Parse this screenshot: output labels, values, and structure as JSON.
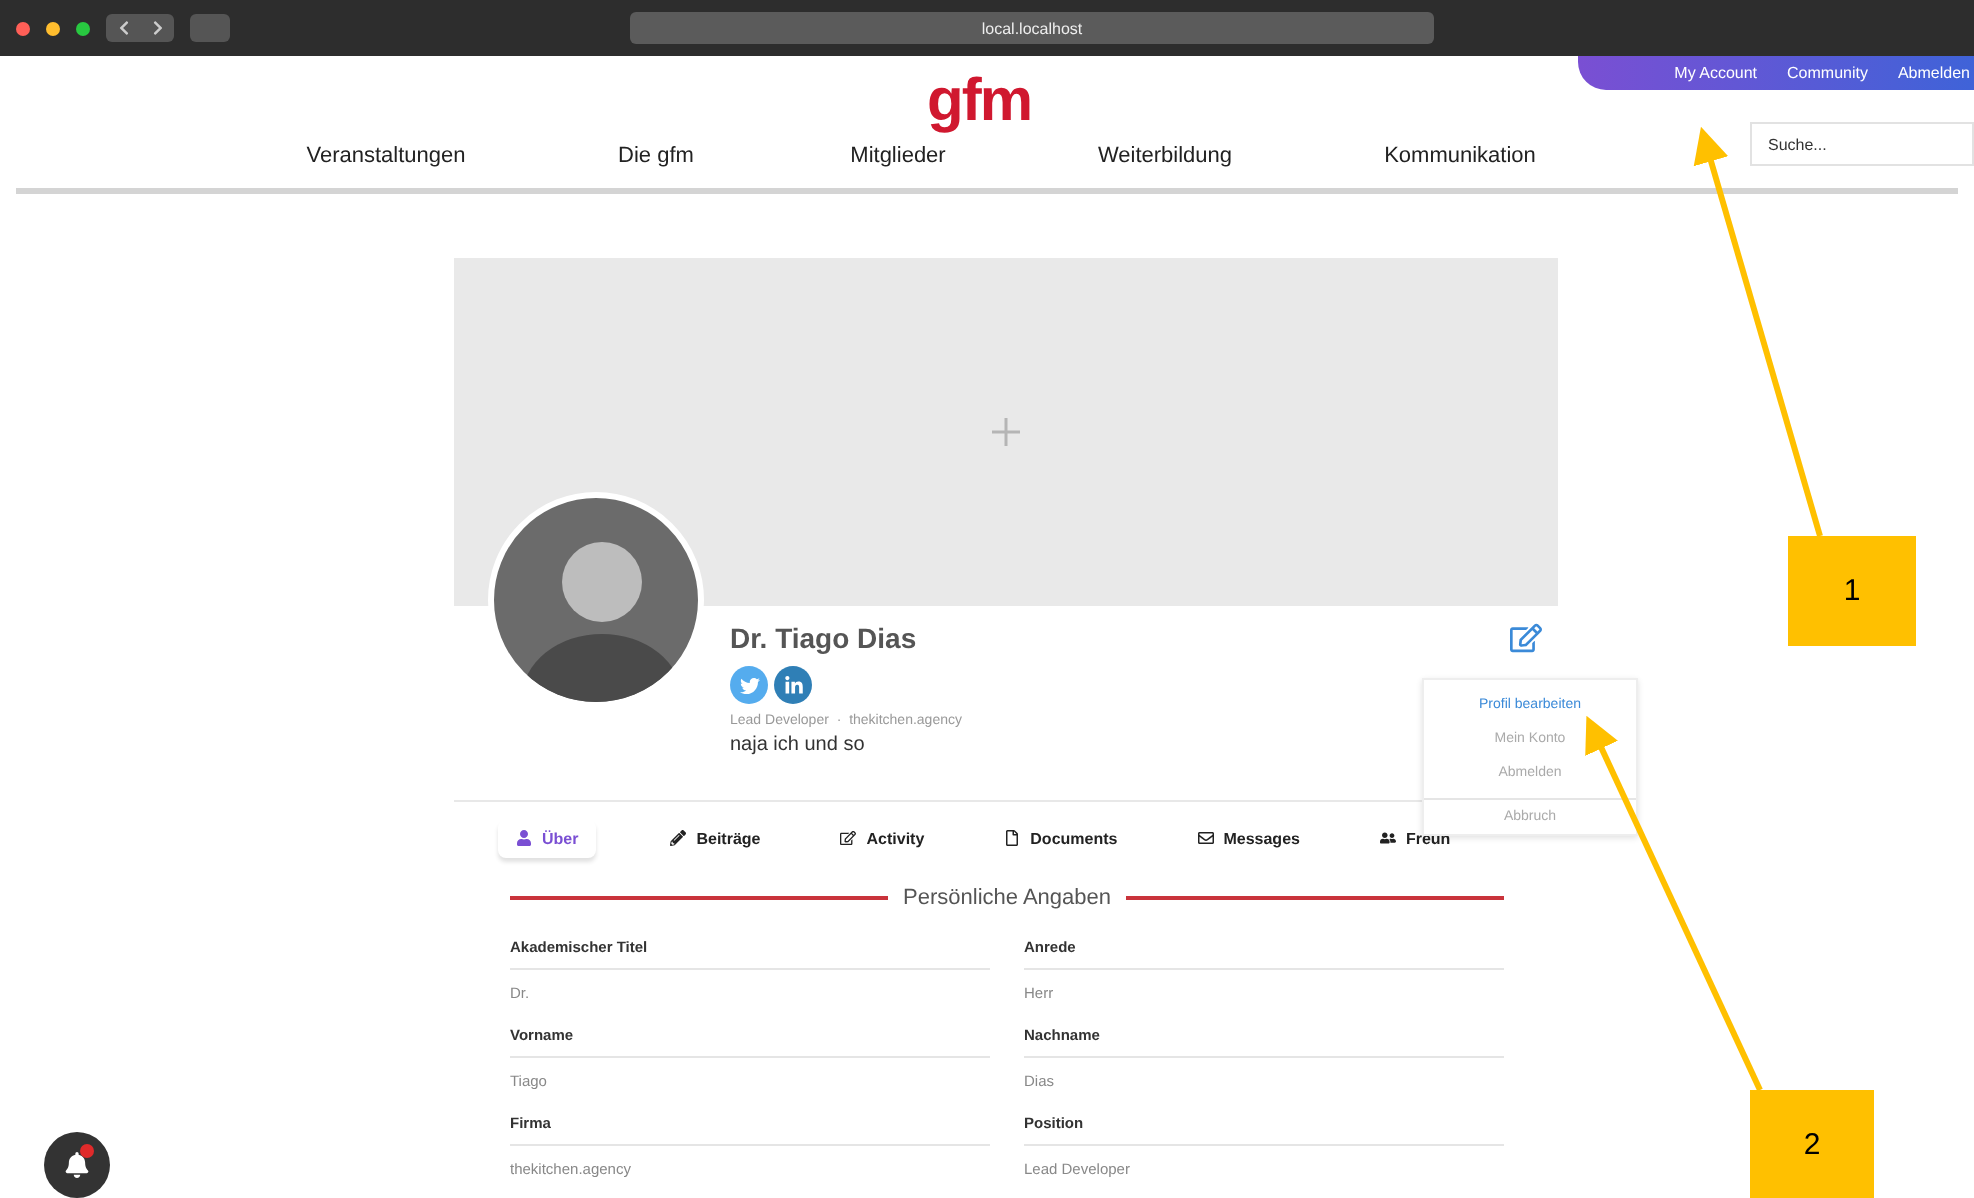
{
  "browser": {
    "address": "local.localhost"
  },
  "logo": "gfm",
  "top_links": [
    {
      "label": "My Account"
    },
    {
      "label": "Community"
    },
    {
      "label": "Abmelden"
    }
  ],
  "search": {
    "placeholder": "Suche..."
  },
  "nav": [
    "Veranstaltungen",
    "Die gfm",
    "Mitglieder",
    "Weiterbildung",
    "Kommunikation"
  ],
  "profile": {
    "name": "Dr. Tiago Dias",
    "role": "Lead Developer",
    "separator": "·",
    "company": "thekitchen.agency",
    "bio": "naja ich und so"
  },
  "socials": [
    {
      "kind": "twitter"
    },
    {
      "kind": "linkedin"
    }
  ],
  "menu": [
    {
      "label": "Profil bearbeiten",
      "selected": true
    },
    {
      "label": "Mein Konto",
      "selected": false
    },
    {
      "label": "Abmelden",
      "selected": false
    },
    {
      "label": "Abbruch",
      "selected": false
    }
  ],
  "tabs": [
    {
      "label": "Über",
      "kind": "user",
      "selected": true
    },
    {
      "label": "Beiträge",
      "kind": "pencil",
      "selected": false
    },
    {
      "label": "Activity",
      "kind": "edit",
      "selected": false
    },
    {
      "label": "Documents",
      "kind": "file",
      "selected": false
    },
    {
      "label": "Messages",
      "kind": "mail",
      "selected": false
    },
    {
      "label": "Freun",
      "kind": "users",
      "selected": false
    }
  ],
  "section": {
    "title": "Persönliche Angaben",
    "fields": [
      {
        "label": "Akademischer Titel",
        "value": "Dr."
      },
      {
        "label": "Anrede",
        "value": "Herr"
      },
      {
        "label": "Vorname",
        "value": "Tiago"
      },
      {
        "label": "Nachname",
        "value": "Dias"
      },
      {
        "label": "Firma",
        "value": "thekitchen.agency"
      },
      {
        "label": "Position",
        "value": "Lead Developer"
      }
    ]
  },
  "annotations": [
    {
      "label": "1"
    },
    {
      "label": "2"
    }
  ]
}
